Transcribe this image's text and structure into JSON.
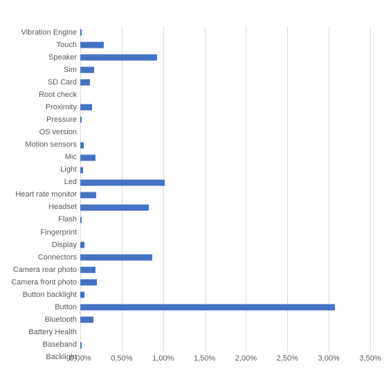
{
  "chart_data": {
    "type": "bar",
    "orientation": "horizontal",
    "title": "",
    "subtitle": "",
    "xlabel": "",
    "ylabel": "",
    "xlim": [
      0,
      3.5
    ],
    "ylim": null,
    "grid": true,
    "legend": false,
    "legend_position": "none",
    "series_color": "#4472C4",
    "value_format": "percent",
    "decimal_separator": ",",
    "xticks": [
      "0,00%",
      "0,50%",
      "1,00%",
      "1,50%",
      "2,00%",
      "2,50%",
      "3,00%",
      "3,50%"
    ],
    "xtick_values": [
      0,
      0.5,
      1.0,
      1.5,
      2.0,
      2.5,
      3.0,
      3.5
    ],
    "categories": [
      "Vibration Engine",
      "Touch",
      "Speaker",
      "Sim",
      "SD Card",
      "Root check",
      "Proximity",
      "Pressure",
      "OS version",
      "Motion sensors",
      "Mic",
      "Light",
      "Led",
      "Heart rate monitor",
      "Headset",
      "Flash",
      "Fingerprint",
      "Display",
      "Connectors",
      "Camera rear photo",
      "Camera front photo",
      "Button backlight",
      "Button",
      "Bluetooth",
      "Battery Health",
      "Baseband",
      "Backlight"
    ],
    "values": [
      0.02,
      0.28,
      0.93,
      0.17,
      0.12,
      0.0,
      0.14,
      0.02,
      0.0,
      0.04,
      0.18,
      0.03,
      1.02,
      0.19,
      0.83,
      0.02,
      0.0,
      0.05,
      0.87,
      0.18,
      0.2,
      0.05,
      3.07,
      0.16,
      0.0,
      0.02,
      0.0
    ]
  }
}
